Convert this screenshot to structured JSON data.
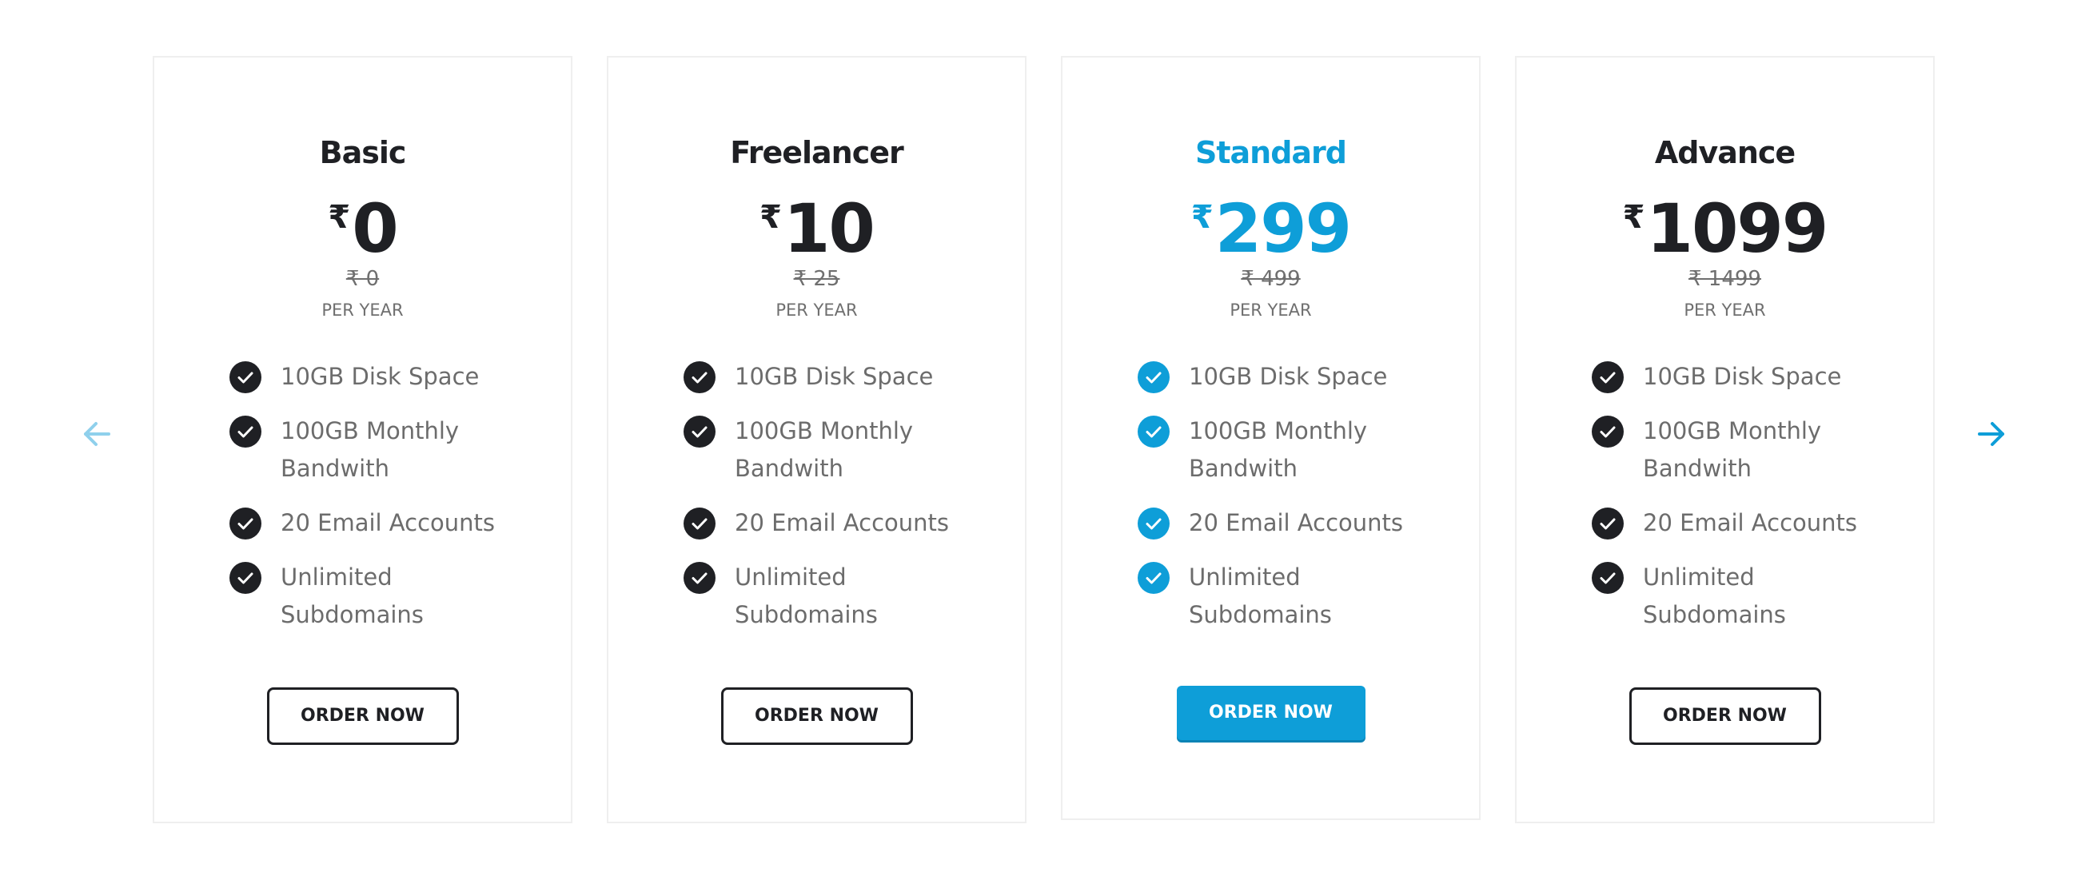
{
  "nav": {
    "prev_icon": "arrow-left-icon",
    "next_icon": "arrow-right-icon",
    "prev_color": "#8fd0ec",
    "next_color": "#0e9ed8"
  },
  "colors": {
    "dark": "#1f2024",
    "accent": "#0e9ed8",
    "muted_text": "#6c6c6c",
    "border": "#efefef"
  },
  "plans": [
    {
      "title": "Basic",
      "currency": "₹",
      "price": "0",
      "old_price": "₹ 0",
      "period": "PER YEAR",
      "features": [
        "10GB Disk Space",
        "100GB Monthly Bandwith",
        "20 Email Accounts",
        "Unlimited Subdomains"
      ],
      "button": "ORDER NOW",
      "featured": false
    },
    {
      "title": "Freelancer",
      "currency": "₹",
      "price": "10",
      "old_price": "₹ 25",
      "period": "PER YEAR",
      "features": [
        "10GB Disk Space",
        "100GB Monthly Bandwith",
        "20 Email Accounts",
        "Unlimited Subdomains"
      ],
      "button": "ORDER NOW",
      "featured": false
    },
    {
      "title": "Standard",
      "currency": "₹",
      "price": "299",
      "old_price": "₹ 499",
      "period": "PER YEAR",
      "features": [
        "10GB Disk Space",
        "100GB Monthly Bandwith",
        "20 Email Accounts",
        "Unlimited Subdomains"
      ],
      "button": "ORDER NOW",
      "featured": true
    },
    {
      "title": "Advance",
      "currency": "₹",
      "price": "1099",
      "old_price": "₹ 1499",
      "period": "PER YEAR",
      "features": [
        "10GB Disk Space",
        "100GB Monthly Bandwith",
        "20 Email Accounts",
        "Unlimited Subdomains"
      ],
      "button": "ORDER NOW",
      "featured": false
    }
  ]
}
